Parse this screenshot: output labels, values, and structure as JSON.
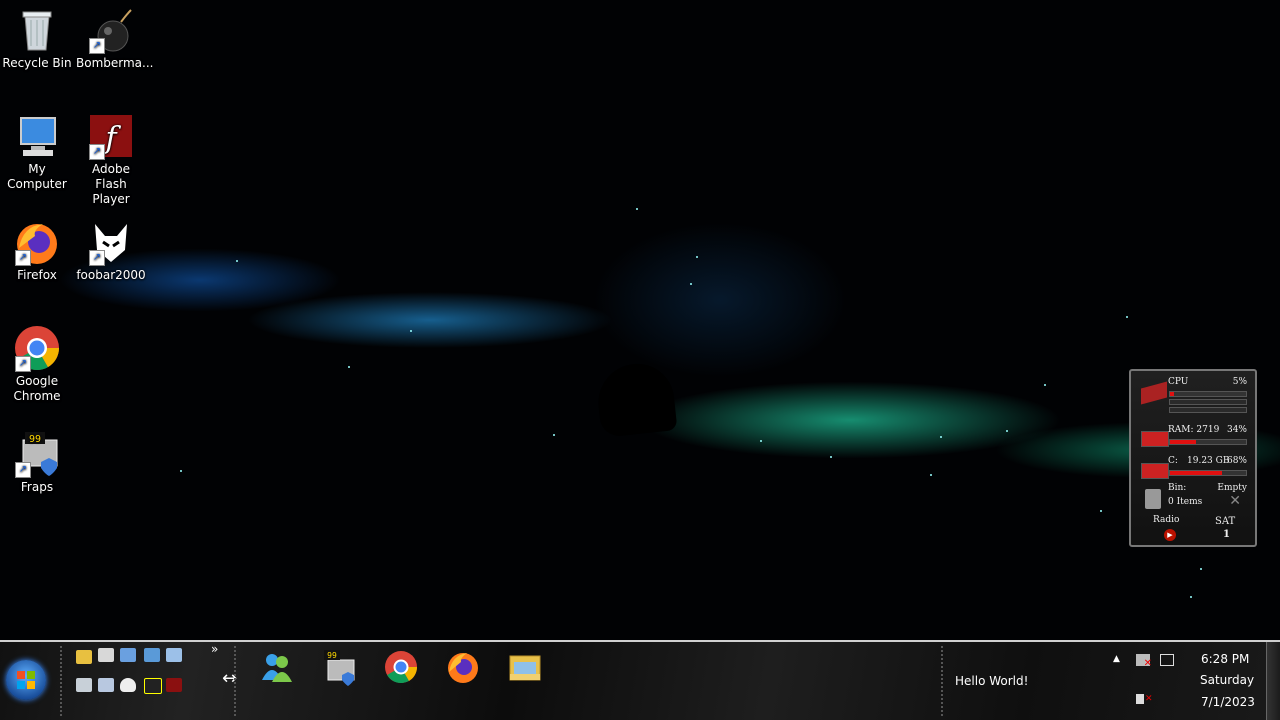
{
  "desktop_icons": [
    {
      "label": "Recycle Bin",
      "icon": "recycle-bin-icon"
    },
    {
      "label": "Bomberma...",
      "icon": "bomb-icon"
    },
    {
      "label": "My\nComputer",
      "icon": "computer-icon"
    },
    {
      "label": "Adobe Flash Player",
      "icon": "flash-icon"
    },
    {
      "label": "Firefox",
      "icon": "firefox-icon"
    },
    {
      "label": "foobar2000",
      "icon": "foobar-icon"
    },
    {
      "label": "Google Chrome",
      "icon": "chrome-icon"
    },
    {
      "label": "Fraps",
      "icon": "fraps-icon"
    }
  ],
  "gadget": {
    "cpu_label": "CPU",
    "cpu_percent": "5%",
    "cpu_value": 5,
    "ram_label": "RAM: 2719",
    "ram_percent": "34%",
    "ram_value": 34,
    "disk_label": "C:",
    "disk_free": "19.23 GB",
    "disk_percent": "68%",
    "disk_value": 68,
    "bin_label": "Bin:",
    "bin_state": "Empty",
    "bin_items": "0 Items",
    "radio_label": "Radio",
    "day": "SAT",
    "date_num": "1"
  },
  "taskbar": {
    "chevron": "»",
    "toolbar_text": "Hello World!",
    "time": "6:28 PM",
    "weekday": "Saturday",
    "date": "7/1/2023",
    "colors": {
      "accent": "#e01010"
    }
  }
}
